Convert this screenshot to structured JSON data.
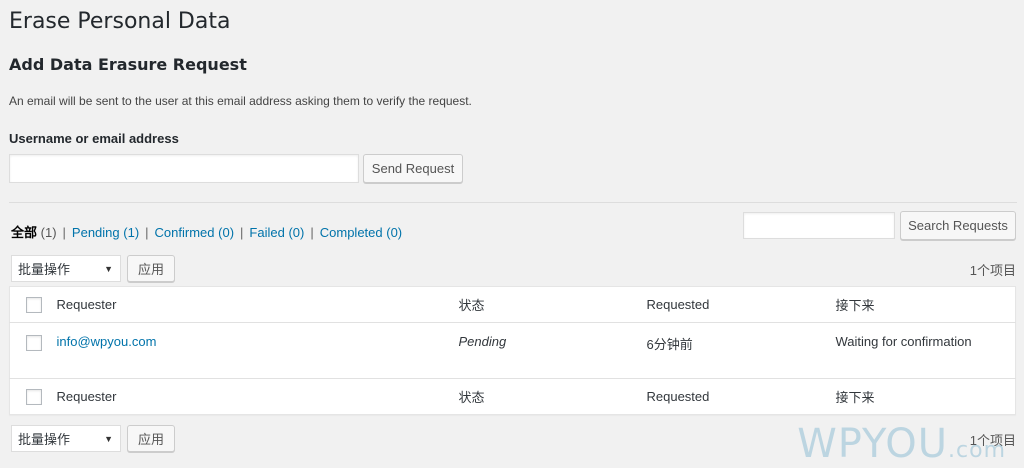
{
  "page": {
    "title": "Erase Personal Data",
    "section_title": "Add Data Erasure Request",
    "description": "An email will be sent to the user at this email address asking them to verify the request."
  },
  "form": {
    "label": "Username or email address",
    "input_value": "",
    "send_button": "Send Request"
  },
  "filters": {
    "all": {
      "label": "全部",
      "count": "(1)"
    },
    "items": [
      {
        "label": "Pending",
        "count": "(1)"
      },
      {
        "label": "Confirmed",
        "count": "(0)"
      },
      {
        "label": "Failed",
        "count": "(0)"
      },
      {
        "label": "Completed",
        "count": "(0)"
      }
    ],
    "separator": "|"
  },
  "search": {
    "input_value": "",
    "button": "Search Requests"
  },
  "tablenav": {
    "bulk_action": "批量操作",
    "apply": "应用",
    "items_count": "1个项目"
  },
  "table": {
    "columns": [
      "Requester",
      "状态",
      "Requested",
      "接下来"
    ],
    "rows": [
      {
        "requester": "info@wpyou.com",
        "status": "Pending",
        "requested": "6分钟前",
        "next_steps": "Waiting for confirmation"
      }
    ]
  },
  "watermark": {
    "main": "WPYOU",
    "suffix": ".com"
  }
}
